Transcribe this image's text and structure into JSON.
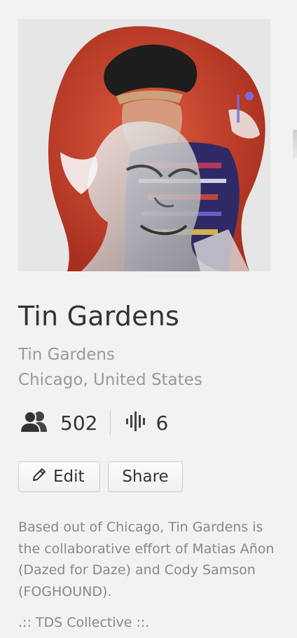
{
  "profile": {
    "name": "Tin Gardens",
    "username": "Tin Gardens",
    "location": "Chicago, United States",
    "avatar_icon": "profile-artwork-image"
  },
  "stats": {
    "followers": "502",
    "followers_icon": "followers-icon",
    "tracks": "6",
    "tracks_icon": "sound-wave-icon"
  },
  "actions": {
    "edit_label": "Edit",
    "edit_icon": "pencil-icon",
    "share_label": "Share"
  },
  "bio": {
    "text": "Based out of Chicago, Tin Gardens is the collaborative effort of Matias Añon (Dazed for Daze) and Cody Samson (FOGHOUND).",
    "extra": ".:: TDS Collective ::."
  },
  "colors": {
    "background": "#f2f2f2",
    "title": "#333333",
    "secondary": "#999999",
    "avatar_accent": "#c9412b"
  }
}
